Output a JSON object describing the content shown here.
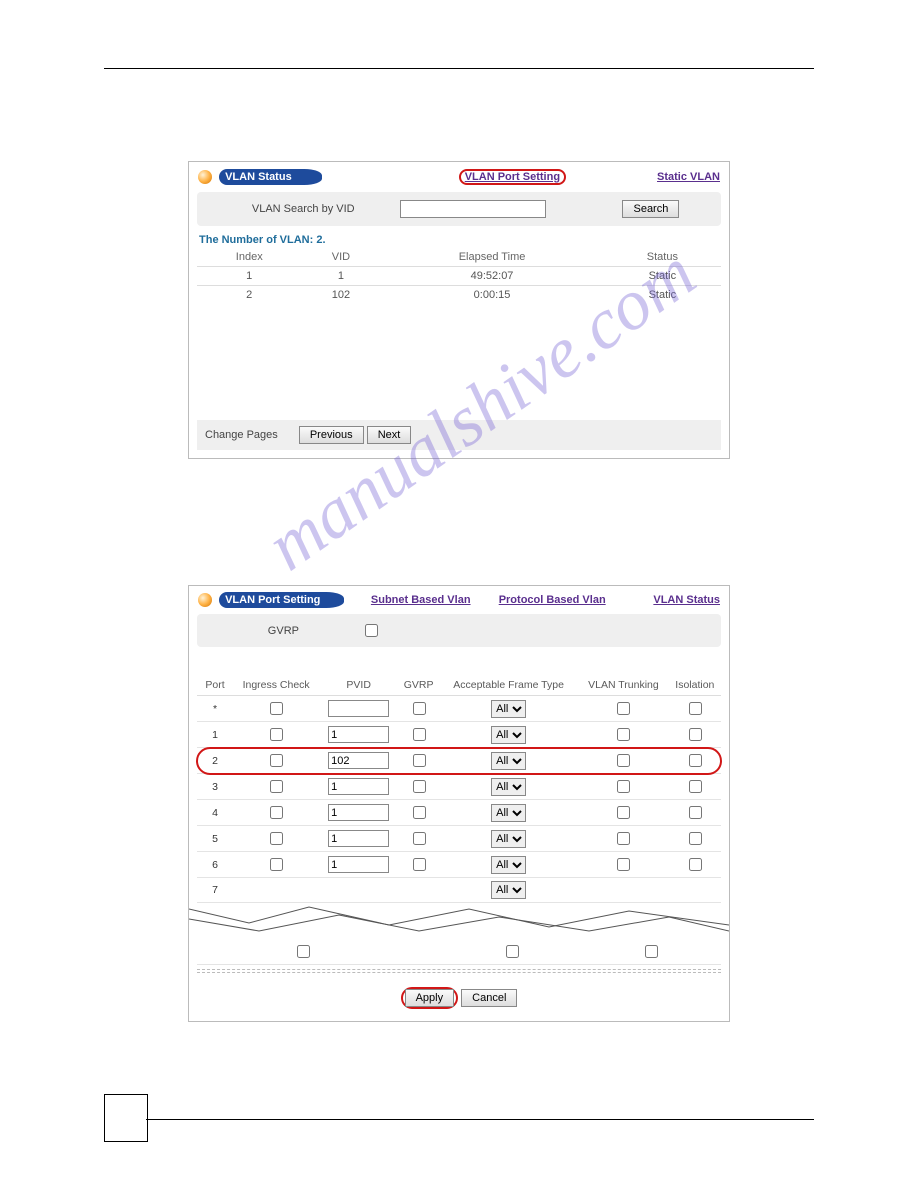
{
  "panel1": {
    "title": "VLAN Status",
    "links": {
      "portSetting": "VLAN Port Setting",
      "staticVlan": "Static VLAN"
    },
    "search": {
      "label": "VLAN Search by VID",
      "button": "Search",
      "value": ""
    },
    "countLabel": "The Number of VLAN: 2.",
    "cols": {
      "index": "Index",
      "vid": "VID",
      "elapsed": "Elapsed Time",
      "status": "Status"
    },
    "rows": [
      {
        "index": "1",
        "vid": "1",
        "elapsed": "49:52:07",
        "status": "Static"
      },
      {
        "index": "2",
        "vid": "102",
        "elapsed": "0:00:15",
        "status": "Static"
      }
    ],
    "pager": {
      "label": "Change Pages",
      "previous": "Previous",
      "next": "Next"
    }
  },
  "panel2": {
    "title": "VLAN Port Setting",
    "links": {
      "subnet": "Subnet Based Vlan",
      "protocol": "Protocol Based Vlan",
      "status": "VLAN Status"
    },
    "gvrpLabel": "GVRP",
    "cols": {
      "port": "Port",
      "ingress": "Ingress Check",
      "pvid": "PVID",
      "gvrp": "GVRP",
      "aft": "Acceptable Frame Type",
      "trunk": "VLAN Trunking",
      "iso": "Isolation"
    },
    "rows": [
      {
        "port": "*",
        "pvid": "",
        "aft": "All"
      },
      {
        "port": "1",
        "pvid": "1",
        "aft": "All"
      },
      {
        "port": "2",
        "pvid": "102",
        "aft": "All"
      },
      {
        "port": "3",
        "pvid": "1",
        "aft": "All"
      },
      {
        "port": "4",
        "pvid": "1",
        "aft": "All"
      },
      {
        "port": "5",
        "pvid": "1",
        "aft": "All"
      },
      {
        "port": "6",
        "pvid": "1",
        "aft": "All"
      },
      {
        "port": "7",
        "pvid": "",
        "aft": "All"
      }
    ],
    "buttons": {
      "apply": "Apply",
      "cancel": "Cancel"
    }
  },
  "watermark": "manualshive.com"
}
